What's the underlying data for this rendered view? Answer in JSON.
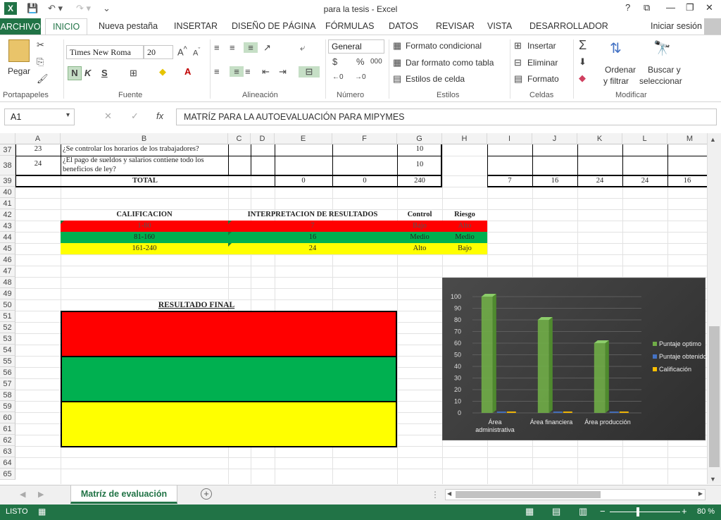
{
  "window": {
    "title": "para la tesis - Excel",
    "help": "?",
    "minimize": "—",
    "restore": "❐",
    "close": "✕"
  },
  "tabs": {
    "file": "ARCHIVO",
    "items": [
      "INICIO",
      "Nueva pestaña",
      "INSERTAR",
      "DISEÑO DE PÁGINA",
      "FÓRMULAS",
      "DATOS",
      "REVISAR",
      "VISTA",
      "DESARROLLADOR"
    ],
    "signin": "Iniciar sesión"
  },
  "ribbon": {
    "clipboard": {
      "paste": "Pegar",
      "label": "Portapapeles"
    },
    "font": {
      "name": "Times New Roma",
      "size": "20",
      "bold": "N",
      "italic": "K",
      "underline": "S",
      "label": "Fuente"
    },
    "alignment": {
      "label": "Alineación"
    },
    "number": {
      "format": "General",
      "label": "Número",
      "currency": "$",
      "percent": "%",
      "thousands": "000"
    },
    "styles": {
      "conditional": "Formato condicional",
      "table": "Dar formato como tabla",
      "cell": "Estilos de celda",
      "label": "Estilos"
    },
    "cells": {
      "insert": "Insertar",
      "delete": "Eliminar",
      "format": "Formato",
      "label": "Celdas"
    },
    "editing": {
      "sort": "Ordenar y filtrar",
      "find": "Buscar y seleccionar",
      "label": "Modificar",
      "sort_line1": "Ordenar",
      "sort_line2": "y filtrar",
      "find_line1": "Buscar y",
      "find_line2": "seleccionar"
    }
  },
  "formula_bar": {
    "name_box": "A1",
    "content": "MATRÍZ PARA LA AUTOEVALUACIÓN PARA MIPYMES",
    "fx": "fx"
  },
  "columns": [
    "A",
    "B",
    "C",
    "D",
    "E",
    "F",
    "G",
    "H",
    "I",
    "J",
    "K",
    "L",
    "M"
  ],
  "rows": [
    "37",
    "38",
    "39",
    "40",
    "41",
    "42",
    "43",
    "44",
    "45",
    "46",
    "47",
    "48",
    "49",
    "50",
    "51",
    "52",
    "53",
    "54",
    "55",
    "56",
    "57",
    "58",
    "59",
    "60",
    "61",
    "62",
    "63",
    "64",
    "65"
  ],
  "cells": {
    "r37": {
      "a": "23",
      "b": "¿Se controlar los horarios de los trabajadores?",
      "g": "10"
    },
    "r38": {
      "a": "24",
      "b1": "¿El pago de sueldos y salarios contiene todo los",
      "b2": "beneficios de ley?",
      "g": "10"
    },
    "r39": {
      "total": "TOTAL",
      "e": "0",
      "f": "0",
      "g": "240",
      "i": "7",
      "j": "16",
      "k": "24",
      "l": "24",
      "m": "16"
    },
    "r42": {
      "calificacion": "CALIFICACIÓN",
      "interpretacion": "INTERPRETACIÓN DE RESULTADOS",
      "control": "Control",
      "riesgo": "Riesgo"
    },
    "r43": {
      "range": "1-80",
      "value": "7",
      "control": "Bajo",
      "riesgo": "Alto"
    },
    "r44": {
      "range": "81-160",
      "value": "16",
      "control": "Medio",
      "riesgo": "Medio"
    },
    "r45": {
      "range": "161-240",
      "value": "24",
      "control": "Alto",
      "riesgo": "Bajo"
    },
    "r50": {
      "resultado": "RESULTADO FINAL"
    }
  },
  "colors": {
    "red": "#ff0000",
    "green": "#00b050",
    "yellow": "#ffff00",
    "excel": "#217346"
  },
  "chart_data": {
    "type": "bar",
    "categories": [
      "Área administrativa",
      "Área financiera",
      "Área producción"
    ],
    "category_lines": [
      [
        "Área",
        "administrativa"
      ],
      [
        "Área financiera"
      ],
      [
        "Área producción"
      ]
    ],
    "series": [
      {
        "name": "Puntaje optimo",
        "color": "#70ad47",
        "values": [
          100,
          80,
          60
        ]
      },
      {
        "name": "Puntaje obtenido",
        "color": "#4472c4",
        "values": [
          0,
          0,
          0
        ]
      },
      {
        "name": "Calificación",
        "color": "#ffc000",
        "values": [
          0,
          0,
          0
        ]
      }
    ],
    "yticks": [
      "0",
      "10",
      "20",
      "30",
      "40",
      "50",
      "60",
      "70",
      "80",
      "90",
      "100"
    ],
    "ylim": [
      0,
      100
    ],
    "legend": "right"
  },
  "sheet": {
    "name": "Matríz de evaluación",
    "add": "+"
  },
  "status": {
    "mode": "LISTO",
    "zoom": "80 %"
  }
}
